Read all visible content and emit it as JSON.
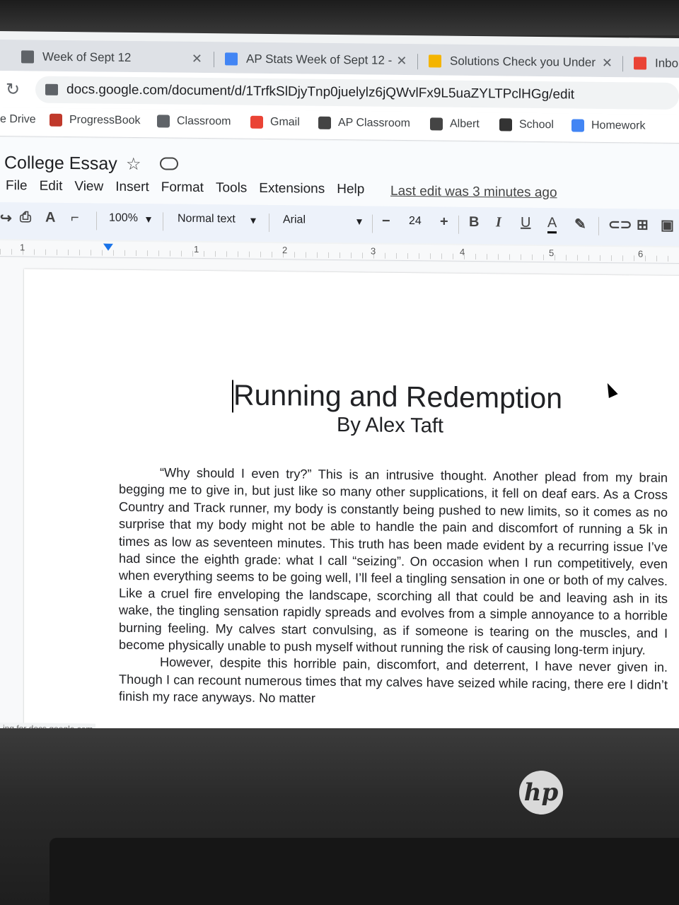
{
  "tabs": [
    {
      "title": "Week of Sept 12",
      "icon": "classroom-icon",
      "color": "#5f6368"
    },
    {
      "title": "AP Stats Week of Sept 12 -",
      "icon": "docs-icon",
      "color": "#4285f4"
    },
    {
      "title": "Solutions Check you Under",
      "icon": "drive-icon",
      "color": "#f4b400"
    },
    {
      "title": "Inbo",
      "icon": "gmail-icon",
      "color": "#ea4335"
    }
  ],
  "address_bar": {
    "url": "docs.google.com/document/d/1TrfkSlDjyTnp0juelylz6jQWvlFx9L5uaZYLTPclHGg/edit"
  },
  "bookmarks": [
    {
      "label": "e Drive",
      "icon": ""
    },
    {
      "label": "ProgressBook",
      "icon": "progressbook-icon",
      "color": "#c0392b"
    },
    {
      "label": "Classroom",
      "icon": "classroom-icon",
      "color": "#5f6368"
    },
    {
      "label": "Gmail",
      "icon": "gmail-icon",
      "color": "#ea4335"
    },
    {
      "label": "AP Classroom",
      "icon": "ap-icon",
      "color": "#444"
    },
    {
      "label": "Albert",
      "icon": "albert-icon",
      "color": "#444"
    },
    {
      "label": "School",
      "icon": "folder-icon",
      "color": "#333"
    },
    {
      "label": "Homework",
      "icon": "docs-icon",
      "color": "#4285f4"
    }
  ],
  "document": {
    "title": "College Essay",
    "last_edit": "Last edit was 3 minutes ago"
  },
  "menus": [
    "File",
    "Edit",
    "View",
    "Insert",
    "Format",
    "Tools",
    "Extensions",
    "Help"
  ],
  "format_toolbar": {
    "zoom": "100%",
    "style": "Normal text",
    "font": "Arial",
    "font_size": "24",
    "minus": "−",
    "plus": "+",
    "bold": "B",
    "italic": "I",
    "underline": "U",
    "text_color": "A"
  },
  "ruler": {
    "numbers": [
      "1",
      "1",
      "2",
      "3",
      "4",
      "5",
      "6"
    ]
  },
  "essay": {
    "title": "Running and Redemption",
    "byline": "By Alex Taft",
    "paragraphs": [
      "“Why should I even try?” This is an intrusive thought. Another plead from my brain begging me to give in, but just like so many other supplications, it fell on deaf ears. As a Cross Country and Track runner, my body is constantly being pushed to new limits, so it comes as no surprise that my body might not be able to handle the pain and discomfort of running a 5k in times as low as seventeen minutes. This truth has been made evident by a recurring issue I’ve had since the eighth grade: what I call “seizing”. On occasion when I run competitively, even when everything seems to be going well, I’ll feel a tingling sensation in one or both of my calves. Like a cruel fire enveloping the landscape, scorching all that could be and leaving ash in its wake, the tingling sensation rapidly spreads and evolves from a simple annoyance to a horrible burning feeling. My calves start convulsing, as if someone is tearing on the muscles, and I become physically unable to push myself without running the risk of causing long-term injury.",
      "However, despite this horrible pain, discomfort, and deterrent, I have never given in. Though I can recount numerous times that my calves have seized while racing, there ere I didn’t finish my race anyways. No matter"
    ]
  },
  "status_text": "ing for docs.google.com",
  "brand": "hp"
}
